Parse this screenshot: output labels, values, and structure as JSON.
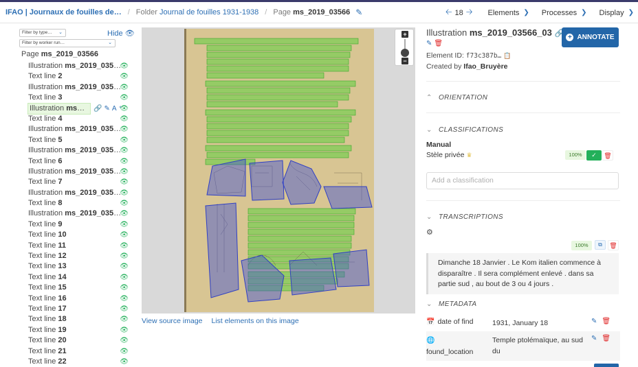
{
  "breadcrumb": {
    "project": "IFAO | Journaux de fouilles de…",
    "folder_prefix": "Folder",
    "folder_name": "Journal de fouilles 1931-1938",
    "page_prefix": "Page",
    "page_name": "ms_2019_03566"
  },
  "topnav": {
    "page_number": "18",
    "elements": "Elements",
    "processes": "Processes",
    "display": "Display"
  },
  "sidebar": {
    "filter_type": "Filter by type…",
    "filter_worker": "Filter by worker run…",
    "hide_label": "Hide",
    "page_prefix": "Page",
    "page_name": "ms_2019_03566",
    "items": [
      {
        "type": "Illustration",
        "name": "ms_2019_03566…"
      },
      {
        "type": "Text line",
        "name": "2"
      },
      {
        "type": "Illustration",
        "name": "ms_2019_03566…"
      },
      {
        "type": "Text line",
        "name": "3"
      },
      {
        "type": "Illustration",
        "name": "ms_20…"
      },
      {
        "type": "Text line",
        "name": "4"
      },
      {
        "type": "Illustration",
        "name": "ms_2019_03566…"
      },
      {
        "type": "Text line",
        "name": "5"
      },
      {
        "type": "Illustration",
        "name": "ms_2019_03566…"
      },
      {
        "type": "Text line",
        "name": "6"
      },
      {
        "type": "Illustration",
        "name": "ms_2019_03566…"
      },
      {
        "type": "Text line",
        "name": "7"
      },
      {
        "type": "Illustration",
        "name": "ms_2019_03566…"
      },
      {
        "type": "Text line",
        "name": "8"
      },
      {
        "type": "Illustration",
        "name": "ms_2019_03566…"
      },
      {
        "type": "Text line",
        "name": "9"
      },
      {
        "type": "Text line",
        "name": "10"
      },
      {
        "type": "Text line",
        "name": "11"
      },
      {
        "type": "Text line",
        "name": "12"
      },
      {
        "type": "Text line",
        "name": "13"
      },
      {
        "type": "Text line",
        "name": "14"
      },
      {
        "type": "Text line",
        "name": "15"
      },
      {
        "type": "Text line",
        "name": "16"
      },
      {
        "type": "Text line",
        "name": "17"
      },
      {
        "type": "Text line",
        "name": "18"
      },
      {
        "type": "Text line",
        "name": "19"
      },
      {
        "type": "Text line",
        "name": "20"
      },
      {
        "type": "Text line",
        "name": "21"
      },
      {
        "type": "Text line",
        "name": "22"
      }
    ]
  },
  "viewer": {
    "view_source": "View source image",
    "list_elements": "List elements on this image"
  },
  "panel": {
    "element_type": "Illustration",
    "element_name": "ms_2019_03566_03",
    "element_id_label": "Element ID:",
    "element_id": "f73c387b…",
    "created_by_label": "Created by",
    "created_by": "Ifao_Bruyère",
    "annotate_label": "ANNOTATE",
    "sections": {
      "orientation": "ORIENTATION",
      "classifications": "CLASSIFICATIONS",
      "transcriptions": "TRANSCRIPTIONS",
      "metadata": "METADATA"
    },
    "classification": {
      "group": "Manual",
      "name": "Stèle privée",
      "confidence": "100%"
    },
    "add_classification_placeholder": "Add a classification",
    "transcription": {
      "confidence": "100%",
      "text": "Dimanche 18 Janvier . Le Kom italien commence à disparaître . Il sera complément enlevé . dans sa partie sud , au bout de 3 ou 4 jours ."
    },
    "metadata": [
      {
        "key": "date of find",
        "value": "1931, January 18"
      },
      {
        "key": "found_location",
        "value": "Temple ptolémaïque, au sud du"
      }
    ]
  },
  "colors": {
    "accent": "#2d6fb4",
    "annotate_button": "#2366a8",
    "eye_green": "#23b05a",
    "delete_red": "#e02a2a",
    "text_line_overlay": "#4fbf3a",
    "illustration_overlay": "#3d4fd6",
    "paper": "#d8c593"
  }
}
